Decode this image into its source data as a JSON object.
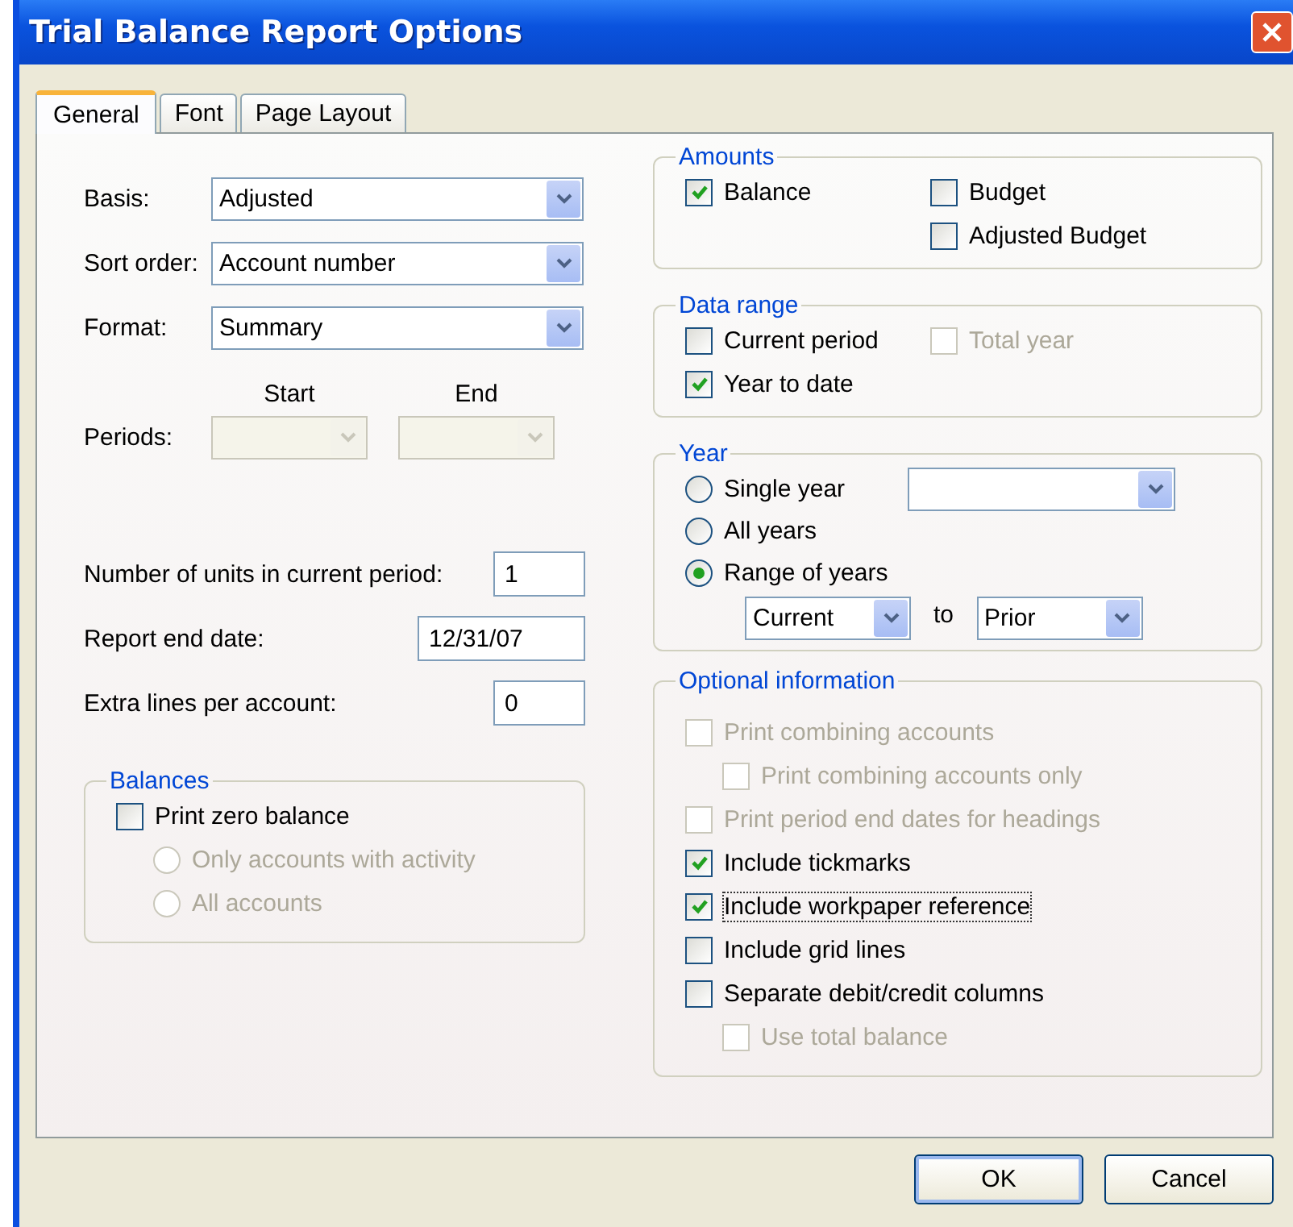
{
  "window": {
    "title": "Trial Balance Report Options"
  },
  "tabs": [
    {
      "label": "General",
      "selected": true
    },
    {
      "label": "Font",
      "selected": false
    },
    {
      "label": "Page Layout",
      "selected": false
    }
  ],
  "dropdowns": [
    {
      "label": "Basis:",
      "value": "Adjusted"
    },
    {
      "label": "Sort order:",
      "value": "Account number"
    },
    {
      "label": "Format:",
      "value": "Summary"
    }
  ],
  "periods": {
    "label": "Periods:",
    "start_label": "Start",
    "end_label": "End",
    "disabled": true
  },
  "fields": [
    {
      "label": "Number of units in current period:",
      "value": "1"
    },
    {
      "label": "Report end date:",
      "value": "12/31/07"
    },
    {
      "label": "Extra lines per account:",
      "value": "0"
    }
  ],
  "balances": {
    "title": "Balances",
    "items": [
      {
        "label": "Print zero balance",
        "checked": false,
        "disabled": false,
        "children": [
          {
            "label": "Only accounts with activity",
            "selected": false,
            "disabled": true
          },
          {
            "label": "All accounts",
            "selected": false,
            "disabled": true
          }
        ]
      }
    ]
  },
  "amounts": {
    "title": "Amounts",
    "columns": [
      [
        {
          "label": "Balance",
          "checked": true,
          "disabled": false
        }
      ],
      [
        {
          "label": "Budget",
          "checked": false,
          "disabled": false
        },
        {
          "label": "Adjusted Budget",
          "checked": false,
          "disabled": false
        }
      ]
    ]
  },
  "data_range": {
    "title": "Data range",
    "columns": [
      [
        {
          "label": "Current period",
          "checked": false,
          "disabled": false
        },
        {
          "label": "Year to date",
          "checked": true,
          "disabled": false
        }
      ],
      [
        {
          "label": "Total year",
          "checked": false,
          "disabled": true
        }
      ]
    ]
  },
  "year": {
    "title": "Year",
    "options": [
      {
        "label": "Single year",
        "selected": false
      },
      {
        "label": "All years",
        "selected": false
      },
      {
        "label": "Range of years",
        "selected": true
      }
    ],
    "range_from": "Current",
    "range_separator": "to",
    "range_to": "Prior"
  },
  "optional_information": {
    "title": "Optional information",
    "items": [
      {
        "label": "Print combining accounts",
        "checked": false,
        "disabled": true,
        "focused": false,
        "children": [
          {
            "label": "Print combining accounts only",
            "checked": false,
            "disabled": true,
            "focused": false
          }
        ]
      },
      {
        "label": "Print period end dates for headings",
        "checked": false,
        "disabled": true,
        "focused": false
      },
      {
        "label": "Include tickmarks",
        "checked": true,
        "disabled": false,
        "focused": false
      },
      {
        "label": "Include workpaper reference",
        "checked": true,
        "disabled": false,
        "focused": true
      },
      {
        "label": "Include grid lines",
        "checked": false,
        "disabled": false,
        "focused": false
      },
      {
        "label": "Separate debit/credit columns",
        "checked": false,
        "disabled": false,
        "focused": false,
        "children": [
          {
            "label": "Use total balance",
            "checked": false,
            "disabled": true,
            "focused": false
          }
        ]
      }
    ]
  },
  "buttons": [
    {
      "label": "OK",
      "default": true
    },
    {
      "label": "Cancel",
      "default": false
    }
  ]
}
